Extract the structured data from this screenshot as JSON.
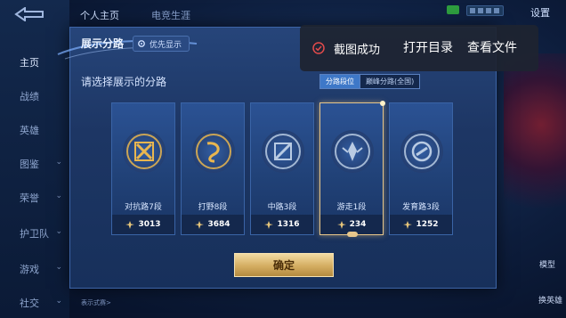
{
  "sidebar": {
    "items": [
      {
        "label": "主页",
        "chevron": false,
        "active": true
      },
      {
        "label": "战绩",
        "chevron": false
      },
      {
        "label": "英雄",
        "chevron": false
      },
      {
        "label": "图鉴",
        "chevron": true
      },
      {
        "label": "荣誉",
        "chevron": true
      },
      {
        "label": "护卫队",
        "chevron": true
      },
      {
        "label": "游戏",
        "chevron": true
      },
      {
        "label": "社交",
        "chevron": true
      }
    ]
  },
  "top_tabs": [
    {
      "label": "个人主页",
      "active": true
    },
    {
      "label": "电竞生涯",
      "active": false
    }
  ],
  "top_right": {
    "settings_label": "设置"
  },
  "right_widgets": {
    "model_label": "模型",
    "change_label": "换英雄"
  },
  "modal": {
    "title": "展示分路",
    "priority_label": "优先显示",
    "select_title": "请选择展示的分路",
    "segments": [
      {
        "label": "分路段位",
        "active": true
      },
      {
        "label": "巅峰分路(全国)",
        "active": false
      }
    ],
    "cards": [
      {
        "rank": "对抗路7段",
        "score": "3013",
        "emblem": "clash-lane-emblem",
        "color": "#e9b64f",
        "selected": false
      },
      {
        "rank": "打野8段",
        "score": "3684",
        "emblem": "jungle-emblem",
        "color": "#e9b64f",
        "selected": false
      },
      {
        "rank": "中路3段",
        "score": "1316",
        "emblem": "mid-lane-emblem",
        "color": "#b9cbe3",
        "selected": false
      },
      {
        "rank": "游走1段",
        "score": "234",
        "emblem": "roam-emblem",
        "color": "#b9cbe3",
        "selected": true
      },
      {
        "rank": "发育路3段",
        "score": "1252",
        "emblem": "farm-lane-emblem",
        "color": "#b9cbe3",
        "selected": false
      }
    ],
    "confirm_label": "确定",
    "foot_note": "表示式赛>"
  },
  "toast": {
    "message": "截图成功",
    "action_open": "打开目录",
    "action_view": "查看文件",
    "icon_color": "#e24b4b"
  }
}
